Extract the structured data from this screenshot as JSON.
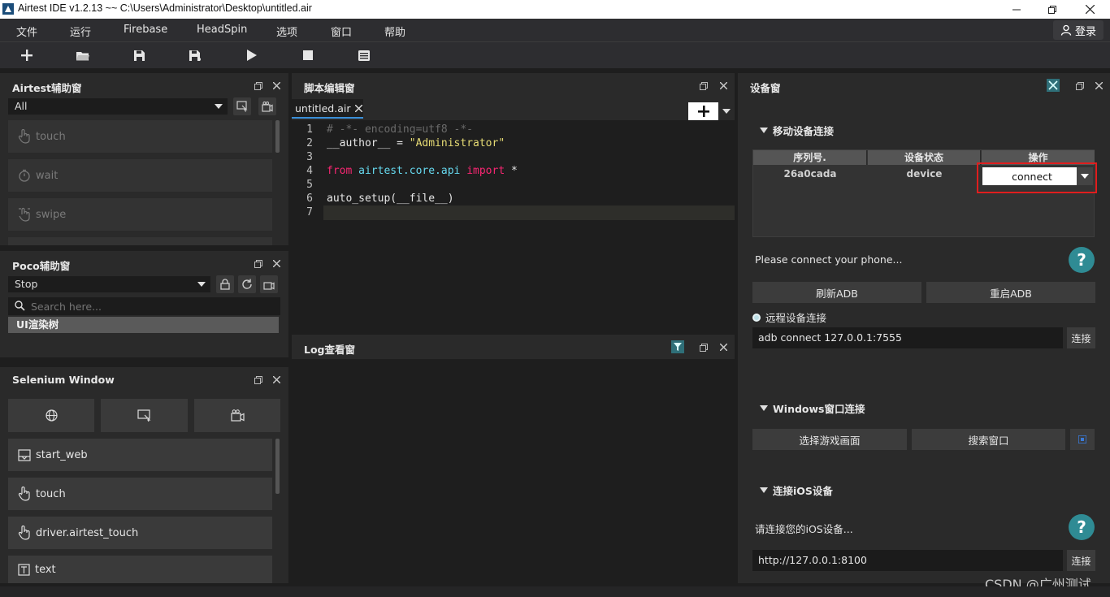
{
  "window": {
    "title": "Airtest IDE v1.2.13 ~~ C:\\Users\\Administrator\\Desktop\\untitled.air"
  },
  "menu": {
    "items": [
      "文件",
      "运行",
      "Firebase",
      "HeadSpin",
      "选项",
      "窗口",
      "帮助"
    ],
    "login_label": "登录"
  },
  "airtest_panel": {
    "title": "Airtest辅助窗",
    "filter_value": "All",
    "actions": [
      "touch",
      "wait",
      "swipe"
    ]
  },
  "poco_panel": {
    "title": "Poco辅助窗",
    "mode_value": "Stop",
    "search_placeholder": "Search here...",
    "tree_label": "UI渲染树"
  },
  "selenium_panel": {
    "title": "Selenium Window",
    "actions": [
      "start_web",
      "touch",
      "driver.airtest_touch",
      "text"
    ]
  },
  "editor_panel": {
    "title": "脚本编辑窗",
    "tab_label": "untitled.air",
    "lines": [
      "1",
      "2",
      "3",
      "4",
      "5",
      "6",
      "7"
    ],
    "code": {
      "l1": "# -*- encoding=utf8 -*-",
      "l2_a": "__author__ = ",
      "l2_b": "\"Administrator\"",
      "l4_a": "from",
      "l4_b": " airtest.core.api ",
      "l4_c": "import",
      "l4_d": " *",
      "l6": "auto_setup(__file__)"
    }
  },
  "log_panel": {
    "title": "Log查看窗"
  },
  "device_panel": {
    "title": "设备窗",
    "mobile_section": "移动设备连接",
    "table_headers": [
      "序列号.",
      "设备状态",
      "操作"
    ],
    "device_serial": "26a0cada",
    "device_status": "device",
    "device_action": "connect",
    "connect_hint": "Please connect your phone...",
    "refresh_adb": "刷新ADB",
    "restart_adb": "重启ADB",
    "remote_label": "远程设备连接",
    "remote_value": "adb connect 127.0.0.1:7555",
    "connect_label": "连接",
    "windows_section": "Windows窗口连接",
    "select_game": "选择游戏画面",
    "search_window": "搜索窗口",
    "ios_section": "连接iOS设备",
    "ios_hint": "请连接您的iOS设备...",
    "ios_value": "http://127.0.0.1:8100",
    "ios_connect_label": "连接"
  },
  "watermark": "CSDN @广州测试",
  "colors": {
    "highlight_border": "#e01e1e",
    "help_accent": "#2f8b94",
    "tab_underline": "#3a8fd8"
  }
}
